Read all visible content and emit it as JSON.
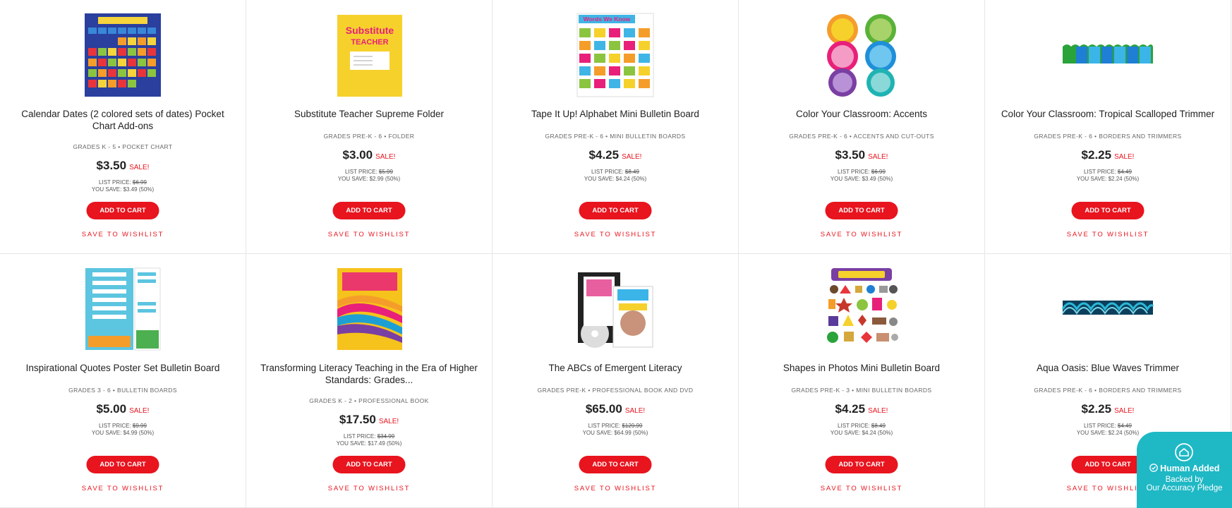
{
  "products": [
    {
      "title": "Calendar Dates (2 colored sets of dates) Pocket Chart Add-ons",
      "meta": "GRADES K - 5 • POCKET CHART",
      "price": "$3.50",
      "sale": "SALE!",
      "list_label": "LIST PRICE:",
      "list_price": "$6.99",
      "save": "YOU SAVE: $3.49 (50%)",
      "cart": "ADD TO CART",
      "wish": "SAVE TO WISHLIST"
    },
    {
      "title": "Substitute Teacher Supreme Folder",
      "meta": "GRADES PRE-K - 6 • FOLDER",
      "price": "$3.00",
      "sale": "SALE!",
      "list_label": "LIST PRICE:",
      "list_price": "$5.99",
      "save": "YOU SAVE: $2.99 (50%)",
      "cart": "ADD TO CART",
      "wish": "SAVE TO WISHLIST",
      "img_title": "Substitute",
      "img_sub": "TEACHER"
    },
    {
      "title": "Tape It Up! Alphabet Mini Bulletin Board",
      "meta": "GRADES PRE-K - 6 • MINI BULLETIN BOARDS",
      "price": "$4.25",
      "sale": "SALE!",
      "list_label": "LIST PRICE:",
      "list_price": "$8.49",
      "save": "YOU SAVE: $4.24 (50%)",
      "cart": "ADD TO CART",
      "wish": "SAVE TO WISHLIST",
      "img_title": "Words We Know"
    },
    {
      "title": "Color Your Classroom: Accents",
      "meta": "GRADES PRE-K - 6 • ACCENTS AND CUT-OUTS",
      "price": "$3.50",
      "sale": "SALE!",
      "list_label": "LIST PRICE:",
      "list_price": "$6.99",
      "save": "YOU SAVE: $3.49 (50%)",
      "cart": "ADD TO CART",
      "wish": "SAVE TO WISHLIST"
    },
    {
      "title": "Color Your Classroom: Tropical Scalloped Trimmer",
      "meta": "GRADES PRE-K - 6 • BORDERS AND TRIMMERS",
      "price": "$2.25",
      "sale": "SALE!",
      "list_label": "LIST PRICE:",
      "list_price": "$4.49",
      "save": "YOU SAVE: $2.24 (50%)",
      "cart": "ADD TO CART",
      "wish": "SAVE TO WISHLIST"
    },
    {
      "title": "Inspirational Quotes Poster Set Bulletin Board",
      "meta": "GRADES 3 - 6 • BULLETIN BOARDS",
      "price": "$5.00",
      "sale": "SALE!",
      "list_label": "LIST PRICE:",
      "list_price": "$9.99",
      "save": "YOU SAVE: $4.99 (50%)",
      "cart": "ADD TO CART",
      "wish": "SAVE TO WISHLIST"
    },
    {
      "title": "Transforming Literacy Teaching in the Era of Higher Standards: Grades...",
      "meta": "GRADES K - 2 • PROFESSIONAL BOOK",
      "price": "$17.50",
      "sale": "SALE!",
      "list_label": "LIST PRICE:",
      "list_price": "$34.99",
      "save": "YOU SAVE: $17.49 (50%)",
      "cart": "ADD TO CART",
      "wish": "SAVE TO WISHLIST"
    },
    {
      "title": "The ABCs of Emergent Literacy",
      "meta": "GRADES PRE-K • PROFESSIONAL BOOK AND DVD",
      "price": "$65.00",
      "sale": "SALE!",
      "list_label": "LIST PRICE:",
      "list_price": "$129.99",
      "save": "YOU SAVE: $64.99 (50%)",
      "cart": "ADD TO CART",
      "wish": "SAVE TO WISHLIST"
    },
    {
      "title": "Shapes in Photos Mini Bulletin Board",
      "meta": "GRADES PRE-K - 3 • MINI BULLETIN BOARDS",
      "price": "$4.25",
      "sale": "SALE!",
      "list_label": "LIST PRICE:",
      "list_price": "$8.49",
      "save": "YOU SAVE: $4.24 (50%)",
      "cart": "ADD TO CART",
      "wish": "SAVE TO WISHLIST"
    },
    {
      "title": "Aqua Oasis: Blue Waves Trimmer",
      "meta": "GRADES PRE-K - 6 • BORDERS AND TRIMMERS",
      "price": "$2.25",
      "sale": "SALE!",
      "list_label": "LIST PRICE:",
      "list_price": "$4.49",
      "save": "YOU SAVE: $2.24 (50%)",
      "cart": "ADD TO CART",
      "wish": "SAVE TO WISHLIST"
    }
  ],
  "badge": {
    "title": "Human Added",
    "line1": "Backed by",
    "line2": "Our Accuracy Pledge"
  },
  "colors": {
    "accent": "#e8141e",
    "badge": "#1fb8c5"
  }
}
